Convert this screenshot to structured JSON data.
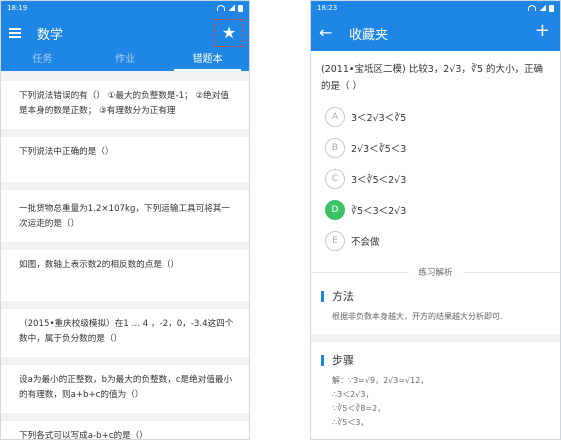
{
  "left": {
    "status": {
      "time": "18:19"
    },
    "title": "数学",
    "tabs": [
      {
        "label": "任务",
        "active": false
      },
      {
        "label": "作业",
        "active": false
      },
      {
        "label": "错题本",
        "active": true
      }
    ],
    "questions": [
      "下列说法错误的有（）  ①最大的负整数是-1；  ②绝对值是本身的数是正数；  ③有理数分为正有理",
      "下列说法中正确的是（）",
      "一批货物总重量为1.2×107kg，下列运输工具可将其一次运走的是（）",
      "如图，数轴上表示数2的相反数的点是（）",
      "（2015•重庆校级模拟）在1 … 4 ，-2，0，-3.4这四个数中，属于负分数的是（）",
      "设a为最小的正整数，b为最大的负整数，c是绝对值最小的有理数，则a+b+c的值为（）",
      "下列各式可以写成a-b+c的是（）"
    ],
    "icons": {
      "menu": "menu-icon",
      "star": "star-icon"
    }
  },
  "right": {
    "status": {
      "time": "18:23"
    },
    "title": "收藏夹",
    "question": "(2011•宝坻区二模) 比较3，2√3，∛5 的大小，正确的是（    ）",
    "options": [
      {
        "letter": "A",
        "text": "3＜2√3＜∛5",
        "selected": false
      },
      {
        "letter": "B",
        "text": "2√3＜∛5＜3",
        "selected": false
      },
      {
        "letter": "C",
        "text": "3＜∛5＜2√3",
        "selected": false
      },
      {
        "letter": "D",
        "text": "∛5＜3＜2√3",
        "selected": true
      },
      {
        "letter": "E",
        "text": "不会做",
        "selected": false
      }
    ],
    "analysis_title": "练习解析",
    "method": {
      "title": "方法",
      "body": "根据非负数本身越大，开方的结果越大分析即可."
    },
    "steps": {
      "title": "步骤",
      "lines": [
        "解：∵3=√9，2√3=√12，",
        "∴3＜2√3，",
        "∵∛5＜∛8=2，",
        "∴∛5＜3，"
      ]
    },
    "icons": {
      "back": "back-arrow-icon",
      "add": "plus-icon"
    }
  },
  "colors": {
    "primary": "#1f86e6",
    "selected_option": "#3cc36a",
    "highlight_box": "#e04a3a"
  }
}
